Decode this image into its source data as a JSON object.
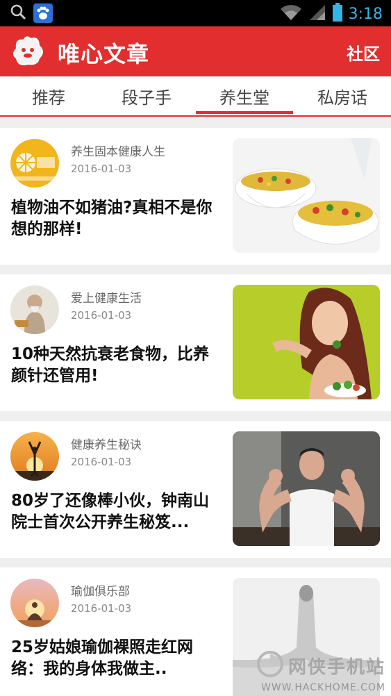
{
  "status": {
    "time": "3:18"
  },
  "app": {
    "title": "唯心文章",
    "community_label": "社区"
  },
  "tabs": [
    {
      "label": "推荐"
    },
    {
      "label": "段子手"
    },
    {
      "label": "养生堂"
    },
    {
      "label": "私房话"
    }
  ],
  "active_tab": "养生堂",
  "articles": [
    {
      "author": "养生固本健康人生",
      "date": "2016-01-03",
      "title": "植物油不如猪油?真相不是你想的那样!"
    },
    {
      "author": "爱上健康生活",
      "date": "2016-01-03",
      "title": "10种天然抗衰老食物，比养颜针还管用!"
    },
    {
      "author": "健康养生秘诀",
      "date": "2016-01-03",
      "title": "80岁了还像棒小伙，钟南山院士首次公开养生秘笈..."
    },
    {
      "author": "瑜伽俱乐部",
      "date": "2016-01-03",
      "title": "25岁姑娘瑜伽裸照走红网络：我的身体我做主.."
    }
  ],
  "watermark": {
    "line1": "网侠手机站",
    "line2": "WWW.HACKHOME.COM"
  },
  "colors": {
    "brand_red": "#e22e2e",
    "status_blue": "#33b5e5"
  }
}
